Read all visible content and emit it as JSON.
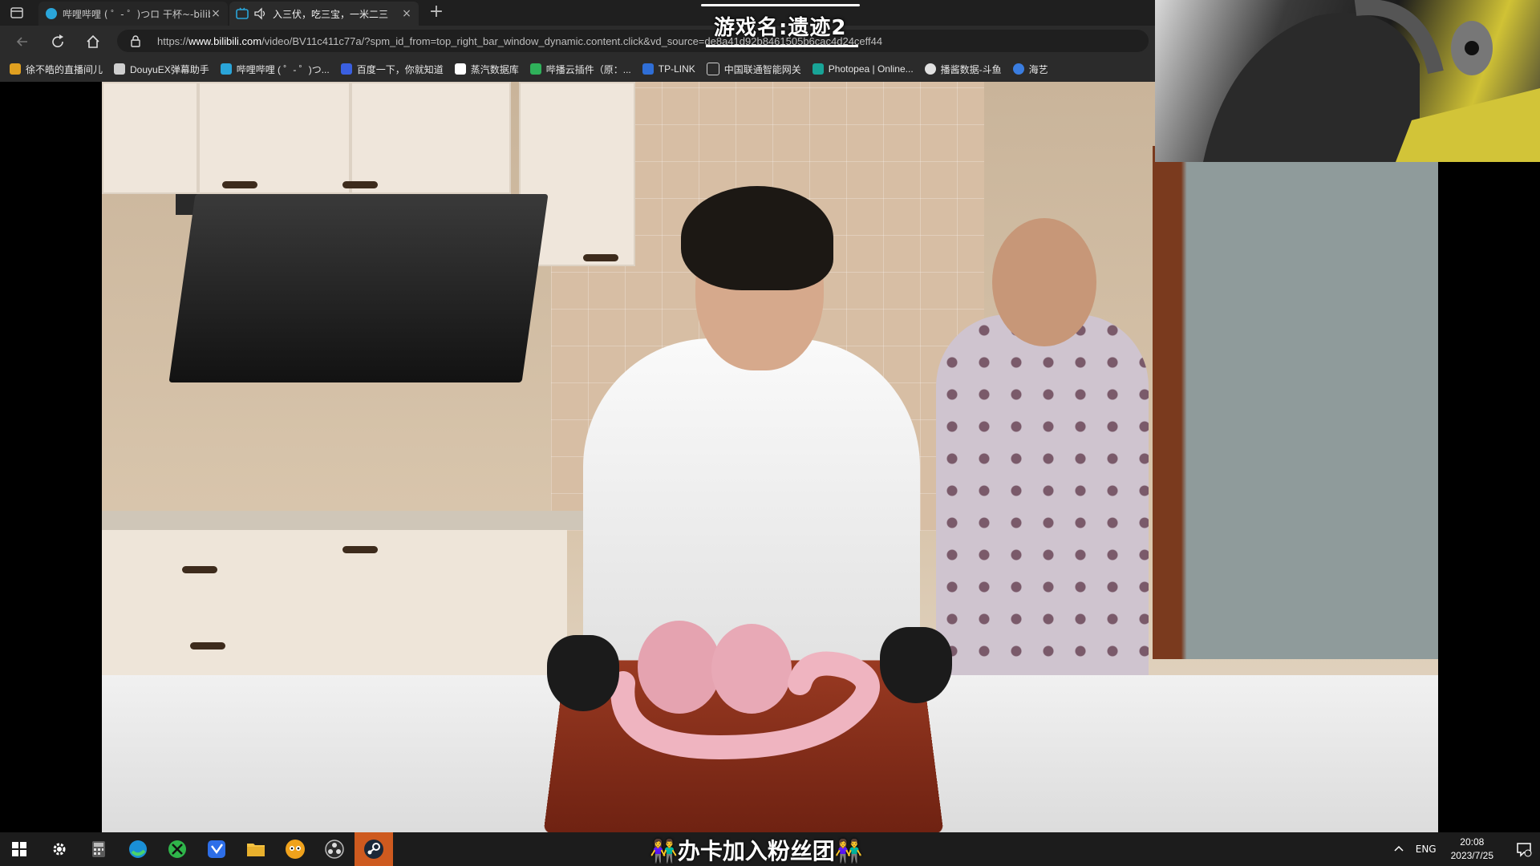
{
  "browser": {
    "tabs": [
      {
        "title": "哔哩哔哩 ( ゜- ゜)つロ 干杯~-bilibili",
        "active": false
      },
      {
        "title": "入三伏，吃三宝，一米二三",
        "active": true
      }
    ],
    "new_tab": "+",
    "url": {
      "prefix": "https://",
      "domain": "www.bilibili.com",
      "path": "/video/BV11c411c77a/?spm_id_from=top_right_bar_window_dynamic.content.click&vd_source=de8a41d92b8461505b6cac4d24ceff44"
    },
    "bookmarks": [
      {
        "label": "徐不皓的直播间儿",
        "color": "#e0a020"
      },
      {
        "label": "DouyuEX弹幕助手",
        "color": "#cfcfcf"
      },
      {
        "label": "哔哩哔哩 ( ゜- ゜)つ...",
        "color": "#2aa5d9"
      },
      {
        "label": "百度一下，你就知道",
        "color": "#3a5fe0"
      },
      {
        "label": "蒸汽数据库",
        "color": "#ffffff"
      },
      {
        "label": "哔播云插件（原：...",
        "color": "#2fb15a"
      },
      {
        "label": "TP-LINK",
        "color": "#2f6ed6"
      },
      {
        "label": "中国联通智能网关",
        "color": "#cfcfcf"
      },
      {
        "label": "Photopea | Online...",
        "color": "#18a497"
      },
      {
        "label": "播酱数据-斗鱼",
        "color": "#e0e0e0"
      },
      {
        "label": "海艺",
        "color": "#3a7de0"
      }
    ]
  },
  "stream_overlay": {
    "game_name": "游戏名:遗迹2",
    "fan_banner": "👫办卡加入粉丝团👫"
  },
  "taskbar": {
    "apps": [
      "start",
      "settings",
      "calculator",
      "edge",
      "xbox",
      "feishu",
      "file-explorer",
      "douyu",
      "obs",
      "steam"
    ],
    "tray": {
      "language": "ENG",
      "time": "20:08",
      "date": "2023/7/25"
    },
    "accent": "#ce5a1f"
  }
}
